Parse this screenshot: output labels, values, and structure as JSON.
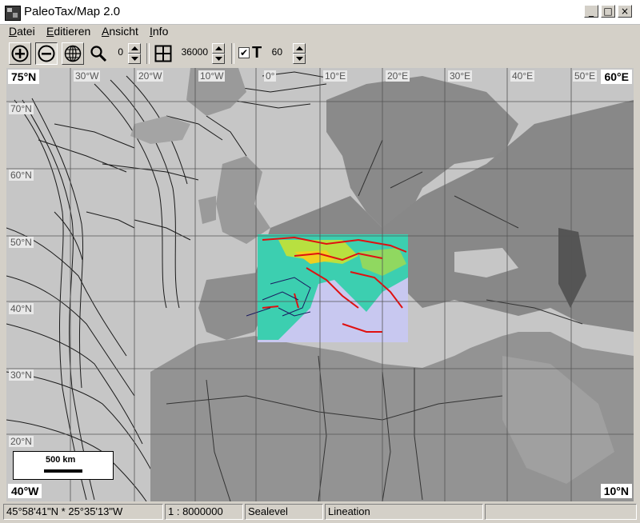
{
  "window": {
    "title": "PaleoTax/Map 2.0",
    "minimize": "_",
    "maximize": "□",
    "close": "×"
  },
  "menu": {
    "items": [
      {
        "label": "Datei",
        "underline": "D"
      },
      {
        "label": "Editieren",
        "underline": "E"
      },
      {
        "label": "Ansicht",
        "underline": "A"
      },
      {
        "label": "Info",
        "underline": "I"
      }
    ]
  },
  "toolbar": {
    "zoom_in_icon": "zoom-in-icon",
    "zoom_out_icon": "zoom-out-icon",
    "globe_icon": "globe-icon",
    "magnifier_icon": "magnifier-icon",
    "zoom_value": "0",
    "grid_icon": "grid-icon",
    "grid_value": "36000",
    "text_checked": true,
    "text_label": "T",
    "text_value": "60"
  },
  "map": {
    "corner_top_left": "75°N",
    "corner_top_right": "60°E",
    "corner_bottom_left": "40°W",
    "corner_bottom_right": "10°N",
    "lon_labels": [
      "30°W",
      "20°W",
      "10°W",
      "0°",
      "10°E",
      "20°E",
      "30°E",
      "40°E",
      "50°E"
    ],
    "lat_labels": [
      "70°N",
      "60°N",
      "50°N",
      "40°N",
      "30°N",
      "20°N"
    ],
    "scale_label": "500 km",
    "colors": {
      "sea": "#c8c8c8",
      "land": "#8e8e8e",
      "overlay_sea": "#c8c8f0",
      "overlay_land": "#3ccfb0",
      "faults": "#e01010",
      "grid": "#555555"
    }
  },
  "status": {
    "coords": "45°58'41\"N *  25°35'13\"W",
    "scale": "1 : 8000000",
    "layer1": "Sealevel",
    "layer2": "Lineation",
    "layer3": ""
  }
}
